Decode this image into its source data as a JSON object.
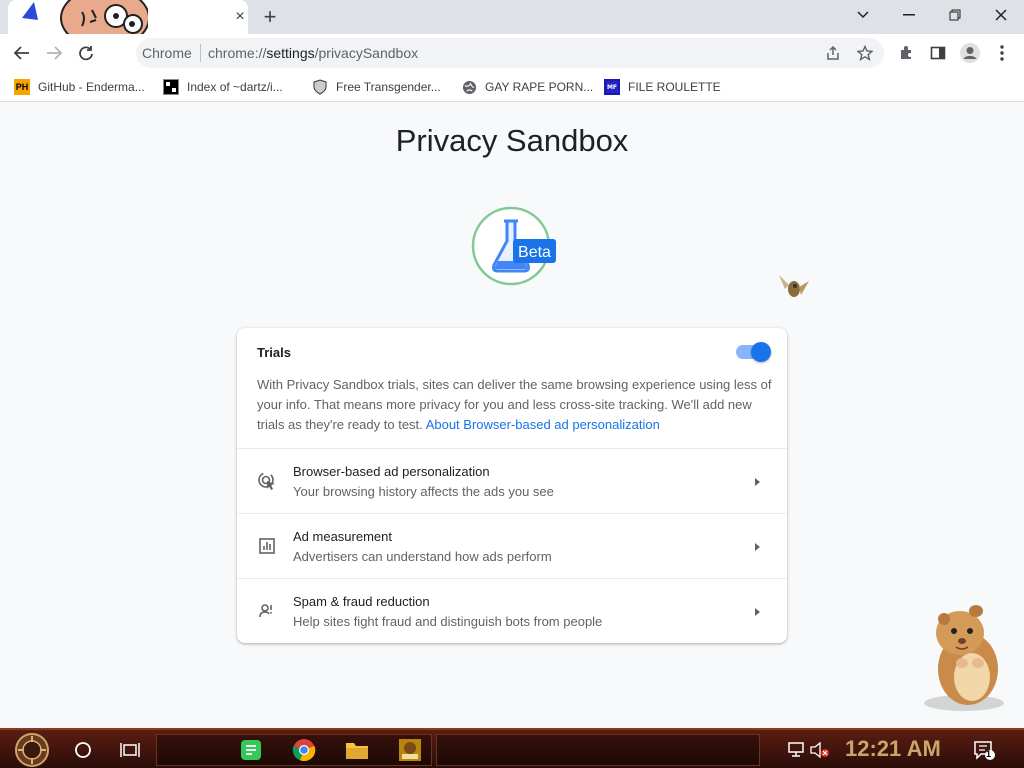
{
  "browser": {
    "tab_close": "×",
    "new_tab": "+",
    "omnibox": {
      "chip": "Chrome",
      "url_prefix": "chrome://",
      "url_host": "settings",
      "url_path": "/privacySandbox"
    }
  },
  "bookmarks": [
    {
      "label": "GitHub - Enderma...",
      "icon_text": "PH",
      "icon": "ph-favicon"
    },
    {
      "label": "Index of ~dartz/i...",
      "icon_text": "",
      "icon": "index-favicon"
    },
    {
      "label": "Free Transgender...",
      "icon_text": "",
      "icon": "shield-favicon"
    },
    {
      "label": "GAY RAPE PORN...",
      "icon_text": "",
      "icon": "globe-favicon"
    },
    {
      "label": "FILE ROULETTE",
      "icon_text": "",
      "icon": "file-favicon"
    }
  ],
  "page": {
    "title": "Privacy Sandbox",
    "beta_badge": "Beta",
    "card": {
      "heading": "Trials",
      "toggle_on": true,
      "description": "With Privacy Sandbox trials, sites can deliver the same browsing experience using less of your info. That means more privacy for you and less cross-site tracking. We'll add new trials as they're ready to test.",
      "link": "About Browser-based ad personalization",
      "rows": [
        {
          "title": "Browser-based ad personalization",
          "subtitle": "Your browsing history affects the ads you see",
          "icon": "ad-personalization-icon"
        },
        {
          "title": "Ad measurement",
          "subtitle": "Advertisers can understand how ads perform",
          "icon": "ad-measurement-icon"
        },
        {
          "title": "Spam & fraud reduction",
          "subtitle": "Help sites fight fraud and distinguish bots from people",
          "icon": "spam-fraud-icon"
        }
      ]
    }
  },
  "taskbar": {
    "clock": "12:21 AM",
    "notification_count": "1"
  },
  "colors": {
    "accent": "#1a73e8",
    "taskbar": "#3a130b",
    "clock": "#c9a56a"
  }
}
